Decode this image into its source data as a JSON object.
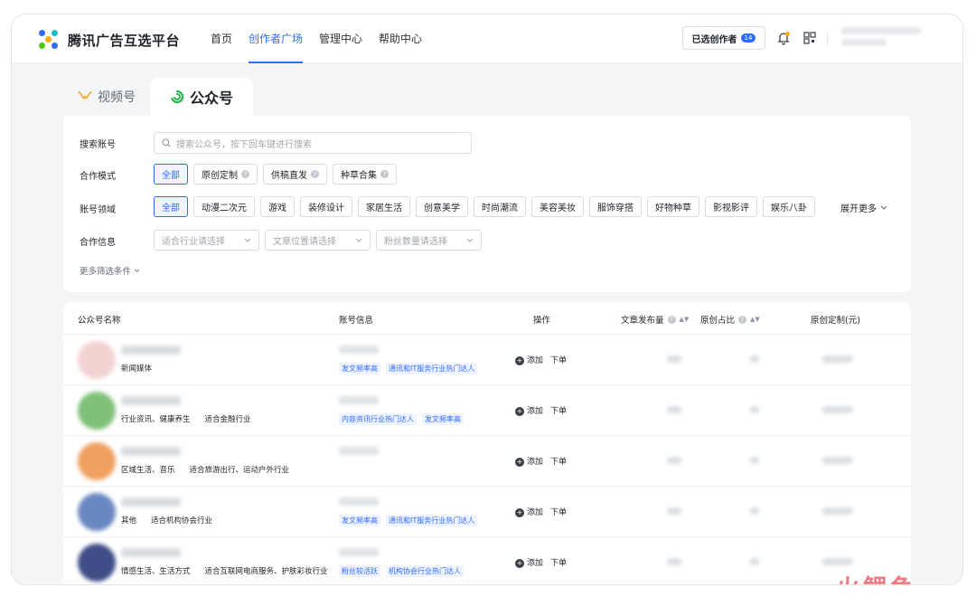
{
  "brand": {
    "name": "腾讯广告互选平台"
  },
  "nav": [
    {
      "label": "首页",
      "active": false
    },
    {
      "label": "创作者广场",
      "active": true
    },
    {
      "label": "管理中心",
      "active": false
    },
    {
      "label": "帮助中心",
      "active": false
    }
  ],
  "header": {
    "selected_label": "已选创作者",
    "selected_count": "14"
  },
  "platform_tabs": [
    {
      "label": "视频号",
      "active": false
    },
    {
      "label": "公众号",
      "active": true
    }
  ],
  "filters": {
    "search_label": "搜索账号",
    "search_placeholder": "搜索公众号，按下回车键进行搜索",
    "mode_label": "合作模式",
    "modes": [
      {
        "label": "全部",
        "on": true,
        "help": false
      },
      {
        "label": "原创定制",
        "on": false,
        "help": true
      },
      {
        "label": "供稿直发",
        "on": false,
        "help": true
      },
      {
        "label": "种草合集",
        "on": false,
        "help": true
      }
    ],
    "domain_label": "账号领域",
    "domains": [
      "全部",
      "动漫二次元",
      "游戏",
      "装修设计",
      "家居生活",
      "创意美学",
      "时尚潮流",
      "美容美妆",
      "服饰穿搭",
      "好物种草",
      "影视影评",
      "娱乐八卦"
    ],
    "expand_label": "展开更多",
    "info_label": "合作信息",
    "selects": [
      "适合行业请选择",
      "文章位置请选择",
      "粉丝数量请选择"
    ],
    "more_label": "更多筛选条件"
  },
  "table": {
    "headers": {
      "name": "公众号名称",
      "account": "账号信息",
      "ops": "操作",
      "posts": "文章发布量",
      "original_ratio": "原创占比",
      "custom_price": "原创定制(元)"
    },
    "add_label": "添加",
    "order_label": "下单",
    "rows": [
      {
        "tags": [
          "新闻媒体"
        ],
        "acct_tags": [
          "发文频率高",
          "通讯和IT服务行业热门达人"
        ],
        "avatar_color": "#f3d2d2"
      },
      {
        "tags": [
          "行业资讯、健康养生",
          "适合金融行业"
        ],
        "acct_tags": [
          "内容资讯行业热门达人",
          "发文频率高"
        ],
        "avatar_color": "#7fc17a"
      },
      {
        "tags": [
          "区域生活、音乐",
          "适合旅游出行、运动户外行业"
        ],
        "acct_tags": [],
        "avatar_color": "#f0a060"
      },
      {
        "tags": [
          "其他",
          "适合机构协会行业"
        ],
        "acct_tags": [
          "发文频率高",
          "通讯和IT服务行业热门达人"
        ],
        "avatar_color": "#6a88c0"
      },
      {
        "tags": [
          "情感生活、生活方式",
          "适合互联网电商服务、护肤彩妆行业"
        ],
        "acct_tags": [
          "粉丝较活跃",
          "机构协会行业热门达人"
        ],
        "avatar_color": "#3f4e86"
      }
    ]
  },
  "watermark": "火鲤鱼",
  "colors": {
    "accent": "#2f6bff",
    "watermark": "#e9656f"
  }
}
